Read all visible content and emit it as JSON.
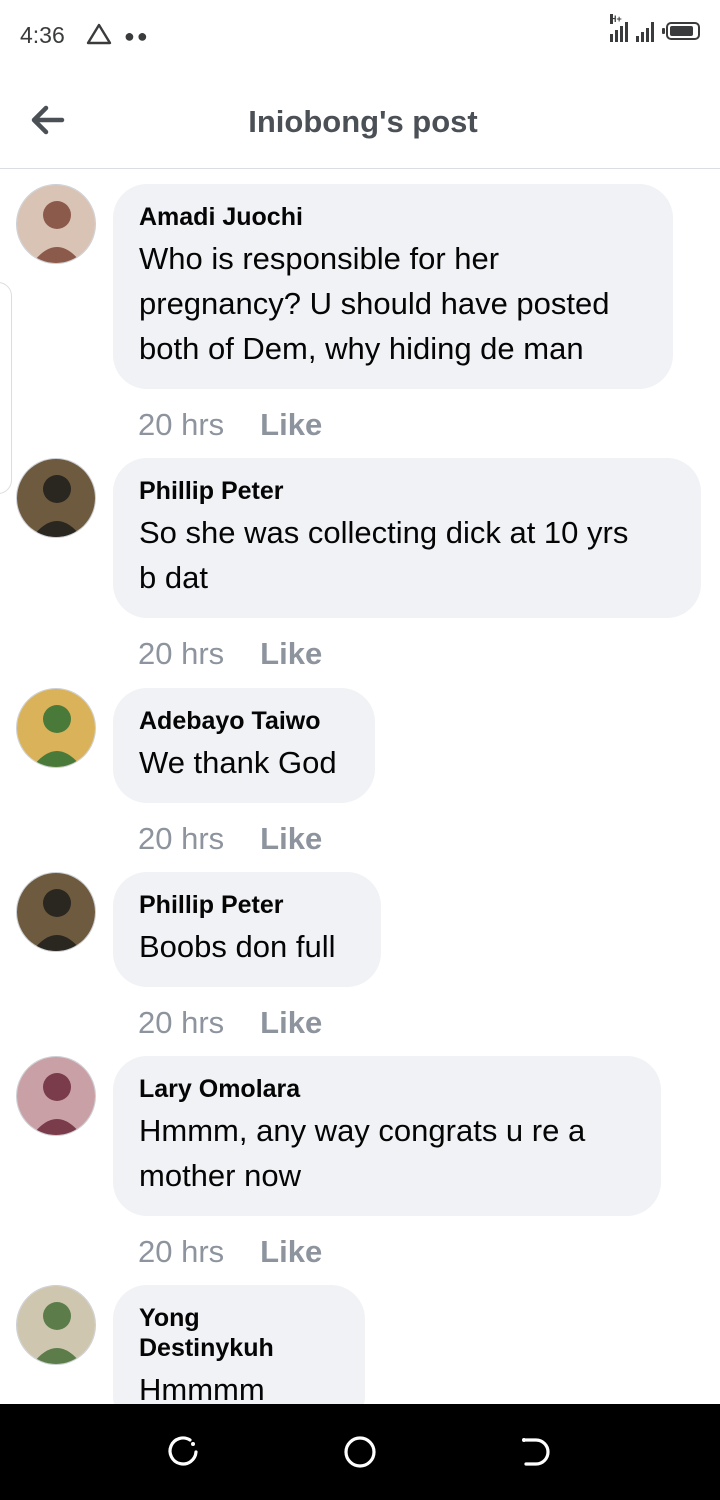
{
  "status_bar": {
    "time": "4:36",
    "network_label": "H+",
    "battery_level_percent": 90
  },
  "header": {
    "title": "Iniobong's post"
  },
  "comments": [
    {
      "author": "Amadi Juochi",
      "text_lines": [
        "Who is responsible for her",
        "pregnancy? U should have posted",
        "both of Dem, why hiding de man"
      ],
      "time": "20 hrs",
      "like_label": "Like",
      "avatar_colors": [
        "#8c5a4a",
        "#d8c3b5"
      ]
    },
    {
      "author": "Phillip Peter",
      "text_lines": [
        "So she was collecting dick at 10 yrs",
        "b dat"
      ],
      "time": "20 hrs",
      "like_label": "Like",
      "avatar_colors": [
        "#2a2620",
        "#6d5a3f"
      ]
    },
    {
      "author": "Adebayo Taiwo",
      "text_lines": [
        "We thank God"
      ],
      "time": "20 hrs",
      "like_label": "Like",
      "avatar_colors": [
        "#4a7a3a",
        "#d9b25a"
      ]
    },
    {
      "author": "Phillip Peter",
      "text_lines": [
        "Boobs don full"
      ],
      "time": "20 hrs",
      "like_label": "Like",
      "avatar_colors": [
        "#2a2620",
        "#6d5a3f"
      ]
    },
    {
      "author": "Lary Omolara",
      "text_lines": [
        "Hmmm, any way congrats u re  a",
        "mother now"
      ],
      "time": "20 hrs",
      "like_label": "Like",
      "avatar_colors": [
        "#7a3b4a",
        "#c9a0a5"
      ]
    },
    {
      "author": "Yong Destinykuh",
      "text_lines": [
        "Hmmmm"
      ],
      "time": "",
      "like_label": "",
      "avatar_colors": [
        "#5c7d4a",
        "#cfc6b0"
      ]
    }
  ],
  "colors": {
    "bubble_bg": "#f0f2f5",
    "meta_text": "#8d949e",
    "header_title": "#4b4f56"
  }
}
